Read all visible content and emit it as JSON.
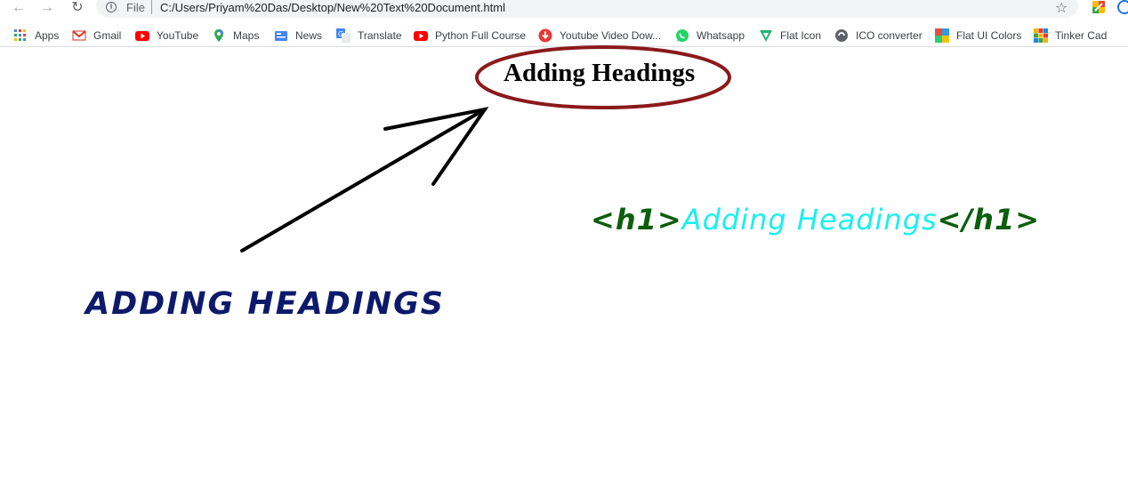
{
  "browser": {
    "scheme_label": "File",
    "url": "C:/Users/Priyam%20Das/Desktop/New%20Text%20Document.html",
    "icons": {
      "back": "arrow-left",
      "forward": "arrow-right",
      "reload": "reload",
      "info": "info",
      "bookmark_star": "star"
    }
  },
  "bookmarks": [
    {
      "label": "Apps",
      "icon": "apps-grid",
      "color": "#5f6368"
    },
    {
      "label": "Gmail",
      "icon": "gmail",
      "color": "#d93025"
    },
    {
      "label": "YouTube",
      "icon": "youtube",
      "color": "#ff0000"
    },
    {
      "label": "Maps",
      "icon": "maps-pin",
      "color": "#34a853"
    },
    {
      "label": "News",
      "icon": "news",
      "color": "#4285f4"
    },
    {
      "label": "Translate",
      "icon": "translate",
      "color": "#4285f4"
    },
    {
      "label": "Python Full Course",
      "icon": "youtube",
      "color": "#ff0000"
    },
    {
      "label": "Youtube Video Dow...",
      "icon": "download-circle",
      "color": "#e53935"
    },
    {
      "label": "Whatsapp",
      "icon": "whatsapp",
      "color": "#25d366"
    },
    {
      "label": "Flat Icon",
      "icon": "flaticon",
      "color": "#22b573"
    },
    {
      "label": "ICO converter",
      "icon": "ico-converter",
      "color": "#5f6368"
    },
    {
      "label": "Flat UI Colors",
      "icon": "flat-ui-colors",
      "color": "#e67e22"
    },
    {
      "label": "Tinker Cad",
      "icon": "tinkercad",
      "color": "#f4b400"
    }
  ],
  "page": {
    "heading": "Adding Headings",
    "code_open_tag": "<h1>",
    "code_text": "Adding Headings",
    "code_close_tag": "</h1>",
    "caption": "ADDING HEADINGS"
  },
  "colors": {
    "ellipse": "#8b1a1a",
    "arrow": "#000000",
    "tag": "#0b5e0b",
    "code_text": "#19f0f0",
    "caption": "#0d1a6b"
  }
}
